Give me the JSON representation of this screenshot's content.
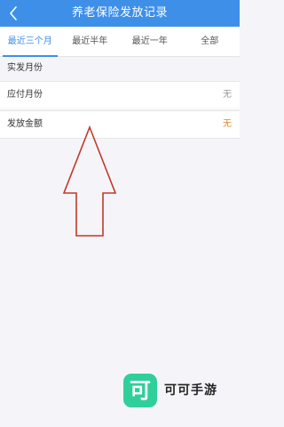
{
  "header": {
    "title": "养老保险发放记录",
    "back_icon": "chevron-left-icon"
  },
  "tabs": [
    {
      "label": "最近三个月",
      "active": true
    },
    {
      "label": "最近半年",
      "active": false
    },
    {
      "label": "最近一年",
      "active": false
    },
    {
      "label": "全部",
      "active": false
    }
  ],
  "section": {
    "title": "实发月份"
  },
  "rows": [
    {
      "label": "应付月份",
      "value": "无",
      "value_color": "#999999"
    },
    {
      "label": "发放金额",
      "value": "无",
      "value_color": "#e0892e"
    }
  ],
  "colors": {
    "accent": "#3e8fe8",
    "arrow": "#c0392b",
    "watermark_logo": "#2fcf9a"
  },
  "watermark": {
    "logo_char": "可",
    "text": "可可手游"
  }
}
